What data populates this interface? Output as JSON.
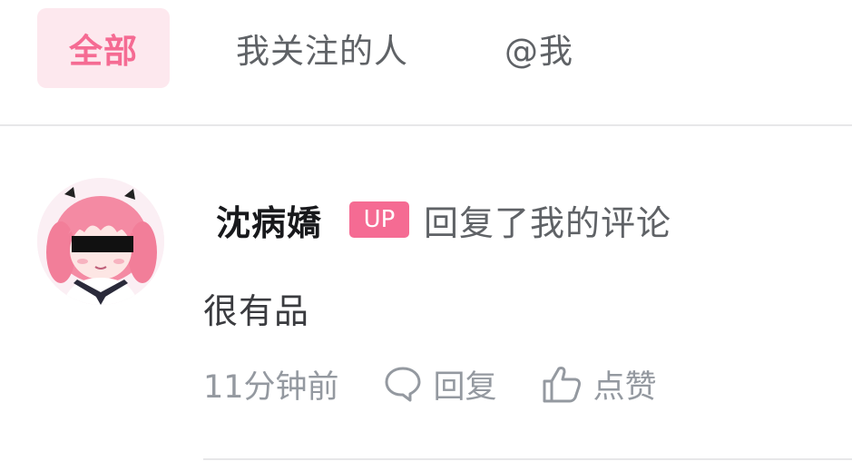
{
  "tabs": [
    {
      "label": "全部",
      "active": true
    },
    {
      "label": "我关注的人",
      "active": false
    },
    {
      "label": "@我",
      "active": false
    }
  ],
  "notification": {
    "username": "沈病嬌",
    "badge": "UP",
    "action": "回复了我的评论",
    "comment": "很有品",
    "time": "11分钟前",
    "reply_label": "回复",
    "like_label": "点赞",
    "avatar_icon": "anime-girl-avatar"
  },
  "colors": {
    "accent": "#f56b93",
    "accent_bg": "#fde8ee",
    "text_primary": "#18191c",
    "text_secondary": "#5f6266",
    "text_meta": "#9499a0",
    "divider": "#e7e7e9"
  }
}
